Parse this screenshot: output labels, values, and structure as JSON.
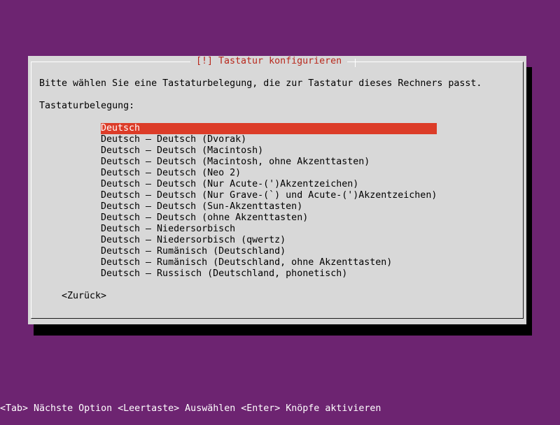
{
  "dialog": {
    "title": "[!] Tastatur konfigurieren",
    "prompt": "Bitte wählen Sie eine Tastaturbelegung, die zur Tastatur dieses Rechners passt.",
    "field_label": "Tastaturbelegung:",
    "selected_index": 0,
    "options": [
      "Deutsch",
      "Deutsch – Deutsch (Dvorak)",
      "Deutsch – Deutsch (Macintosh)",
      "Deutsch – Deutsch (Macintosh, ohne Akzenttasten)",
      "Deutsch – Deutsch (Neo 2)",
      "Deutsch – Deutsch (Nur Acute-(')Akzentzeichen)",
      "Deutsch – Deutsch (Nur Grave-(`) und Acute-(')Akzentzeichen)",
      "Deutsch – Deutsch (Sun-Akzenttasten)",
      "Deutsch – Deutsch (ohne Akzenttasten)",
      "Deutsch – Niedersorbisch",
      "Deutsch – Niedersorbisch (qwertz)",
      "Deutsch – Rumänisch (Deutschland)",
      "Deutsch – Rumänisch (Deutschland, ohne Akzenttasten)",
      "Deutsch – Russisch (Deutschland, phonetisch)"
    ],
    "back_button": "<Zurück>"
  },
  "statusbar": {
    "text": "<Tab> Nächste Option <Leertaste> Auswählen <Enter> Knöpfe aktivieren"
  },
  "colors": {
    "background": "#6d2471",
    "dialog": "#d8d8d8",
    "title": "#b8281c",
    "selection": "#dc3c28"
  }
}
